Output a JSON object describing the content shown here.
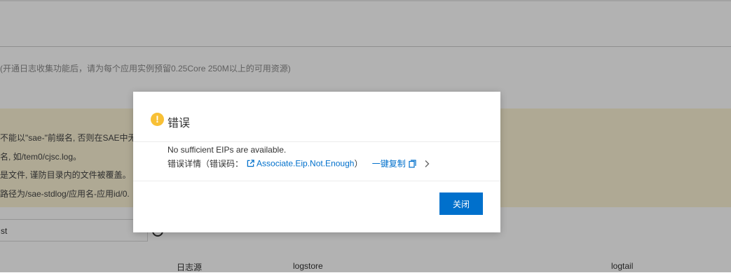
{
  "background": {
    "hint": "(开通日志收集功能后，请为每个应用实例预留0.25Core 250M以上的可用资源)",
    "warning_lines": [
      "不能以\"sae-\"前缀名, 否则在SAE中无法",
      "名, 如/tem0/cjsc.log。",
      "是文件, 谨防目录内的文件被覆盖。",
      "路径为/sae-stdlog/应用名-应用id/0."
    ],
    "input_value": "st",
    "columns": [
      "日志源",
      "logstore",
      "logtail"
    ]
  },
  "dialog": {
    "title": "错误",
    "message": "No sufficient EIPs are available.",
    "detail_prefix": "错误详情（错误码：",
    "error_code": "Associate.Eip.Not.Enough",
    "detail_suffix": "）",
    "copy_label": "一键复制",
    "close_label": "关闭"
  },
  "colors": {
    "accent": "#0070cc",
    "warning_icon": "#f8c035",
    "warning_bg": "#fbf3d5"
  }
}
